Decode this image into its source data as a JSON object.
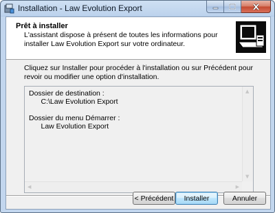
{
  "window": {
    "title": "Installation - Law Evolution Export",
    "app_icon": "setup-icon"
  },
  "header": {
    "title": "Prêt à installer",
    "subtitle": "L'assistant dispose à présent de toutes les informations pour installer Law Evolution Export sur votre ordinateur.",
    "image_icon": "wizard-computer-icon"
  },
  "body": {
    "intro": "Cliquez sur Installer pour procéder à l'installation ou sur Précédent pour revoir ou modifier une option d'installation.",
    "memo": "Dossier de destination :\n      C:\\Law Evolution Export\n\nDossier du menu Démarrer :\n      Law Evolution Export"
  },
  "buttons": {
    "back": "< Précédent",
    "install": "Installer",
    "cancel": "Annuler"
  },
  "colors": {
    "title_bar": "#bcd2ec",
    "close_button": "#c4492f",
    "default_button_border": "#3c7fb1"
  }
}
